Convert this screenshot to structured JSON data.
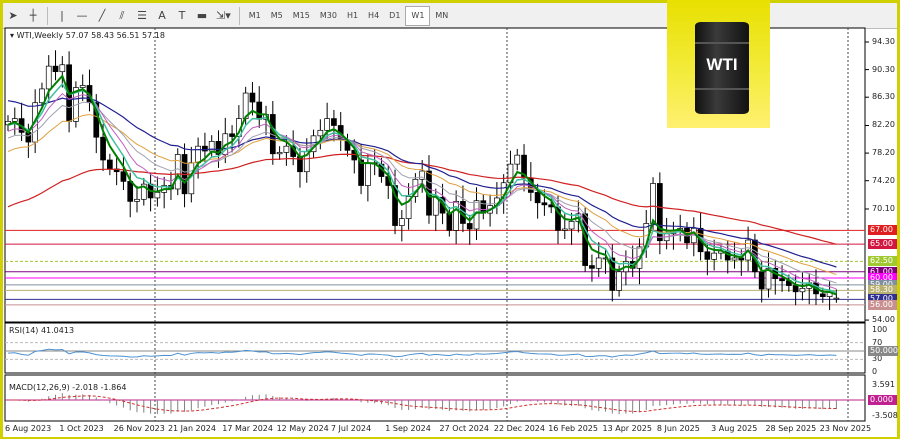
{
  "toolbar": {
    "tools": [
      {
        "name": "cursor-icon",
        "g": "➤"
      },
      {
        "name": "crosshair-icon",
        "g": "┼"
      },
      {
        "name": "vertical-line-icon",
        "g": "|"
      },
      {
        "name": "horizontal-line-icon",
        "g": "—"
      },
      {
        "name": "trendline-icon",
        "g": "╱"
      },
      {
        "name": "equidistant-channel-icon",
        "g": "⫽"
      },
      {
        "name": "fibonacci-icon",
        "g": "☰"
      },
      {
        "name": "text-icon",
        "g": "A"
      },
      {
        "name": "text-label-icon",
        "g": "T"
      },
      {
        "name": "rectangle-icon",
        "g": "▬"
      },
      {
        "name": "arrows-icon",
        "g": "⇲▾"
      }
    ],
    "timeframes": [
      "M1",
      "M5",
      "M15",
      "M30",
      "H1",
      "H4",
      "D1",
      "W1",
      "MN"
    ],
    "active_timeframe": "W1"
  },
  "symbol": {
    "header": "WTI,Weekly",
    "open": "57.07",
    "high": "58.43",
    "low": "56.51",
    "close": "57.18"
  },
  "logo": {
    "text": "WTI"
  },
  "price_axis": [
    "94.30",
    "90.30",
    "86.30",
    "82.20",
    "78.20",
    "74.20",
    "70.10",
    "54.00"
  ],
  "level_labels": [
    {
      "text": "67.00",
      "value": 67,
      "color": "#e02020"
    },
    {
      "text": "65.00",
      "value": 65,
      "color": "#d01840"
    },
    {
      "text": "62.50",
      "value": 62.5,
      "color": "#a0c830"
    },
    {
      "text": "61.00",
      "value": 61,
      "color": "#800080"
    },
    {
      "text": "60.00",
      "value": 60.1,
      "color": "#ff00ff"
    },
    {
      "text": "59.00",
      "value": 59.1,
      "color": "#8090a0"
    },
    {
      "text": "58.30",
      "value": 58.3,
      "color": "#b8b070"
    },
    {
      "text": "57.00",
      "value": 57,
      "color": "#303090"
    },
    {
      "text": "56.00",
      "value": 56.2,
      "color": "#c89090"
    }
  ],
  "rsi": {
    "label": "RSI(14) 41.0413",
    "axis": [
      "100",
      "70",
      "30",
      "0"
    ],
    "current_label": "50.000"
  },
  "macd": {
    "label": "MACD(12,26,9) -2.018 -1.864",
    "axis": [
      "3.591",
      "-3.508"
    ],
    "zero_label": "0.000"
  },
  "x_axis": [
    "6 Aug 2023",
    "1 Oct 2023",
    "26 Nov 2023",
    "21 Jan 2024",
    "17 Mar 2024",
    "12 May 2024",
    "7 Jul 2024",
    "1 Sep 2024",
    "27 Oct 2024",
    "22 Dec 2024",
    "16 Feb 2025",
    "13 Apr 2025",
    "8 Jun 2025",
    "3 Aug 2025",
    "28 Sep 2025",
    "23 Nov 2025"
  ],
  "weekly_closes": [
    82.8,
    83.2,
    81.2,
    79.8,
    85.5,
    87.5,
    90.8,
    90.0,
    91.0,
    82.8,
    87.7,
    88.0,
    85.5,
    80.5,
    77.2,
    75.9,
    75.5,
    74.1,
    71.2,
    71.5,
    73.7,
    71.7,
    72.5,
    73.5,
    73.0,
    78.0,
    72.3,
    76.8,
    79.2,
    78.5,
    79.9,
    78.0,
    81.0,
    80.6,
    83.2,
    86.9,
    85.6,
    83.1,
    83.8,
    78.1,
    78.3,
    79.2,
    77.7,
    75.5,
    78.4,
    80.7,
    81.5,
    83.2,
    82.2,
    80.1,
    78.6,
    77.2,
    73.5,
    76.8,
    76.6,
    74.8,
    73.5,
    67.7,
    68.7,
    71.9,
    74.4,
    75.6,
    69.2,
    71.8,
    69.5,
    67.0,
    71.2,
    68.0,
    67.2,
    71.3,
    69.5,
    70.6,
    71.7,
    73.9,
    76.6,
    77.9,
    74.6,
    72.5,
    71.0,
    70.7,
    70.4,
    67.0,
    67.2,
    68.3,
    69.4,
    61.9,
    61.5,
    63.0,
    63.0,
    58.3,
    61.0,
    62.5,
    61.5,
    64.6,
    68.0,
    73.8,
    65.5,
    66.5,
    67.0,
    67.3,
    65.2,
    67.3,
    63.9,
    62.8,
    63.7,
    64.0,
    62.7,
    63.0,
    62.7,
    65.6,
    61.0,
    58.5,
    61.5,
    60.0,
    59.7,
    59.0,
    58.1,
    58.6,
    59.4,
    57.8,
    57.4,
    58.0,
    57.18
  ],
  "colors": {
    "frame": "#d0d000",
    "bull": "#ffffff",
    "bear": "#000000",
    "ema_fast": "#008000",
    "ema_teal": "#40c0a0",
    "ma_violet": "#c060c0",
    "ma_gray": "#a0a0b0",
    "ma_tan": "#e0a040",
    "ma_navy": "#202090",
    "ma_red": "#d02020",
    "rsi_line": "#4a90d0",
    "macd_signal": "#d03030",
    "macd_hist": "#808080"
  }
}
